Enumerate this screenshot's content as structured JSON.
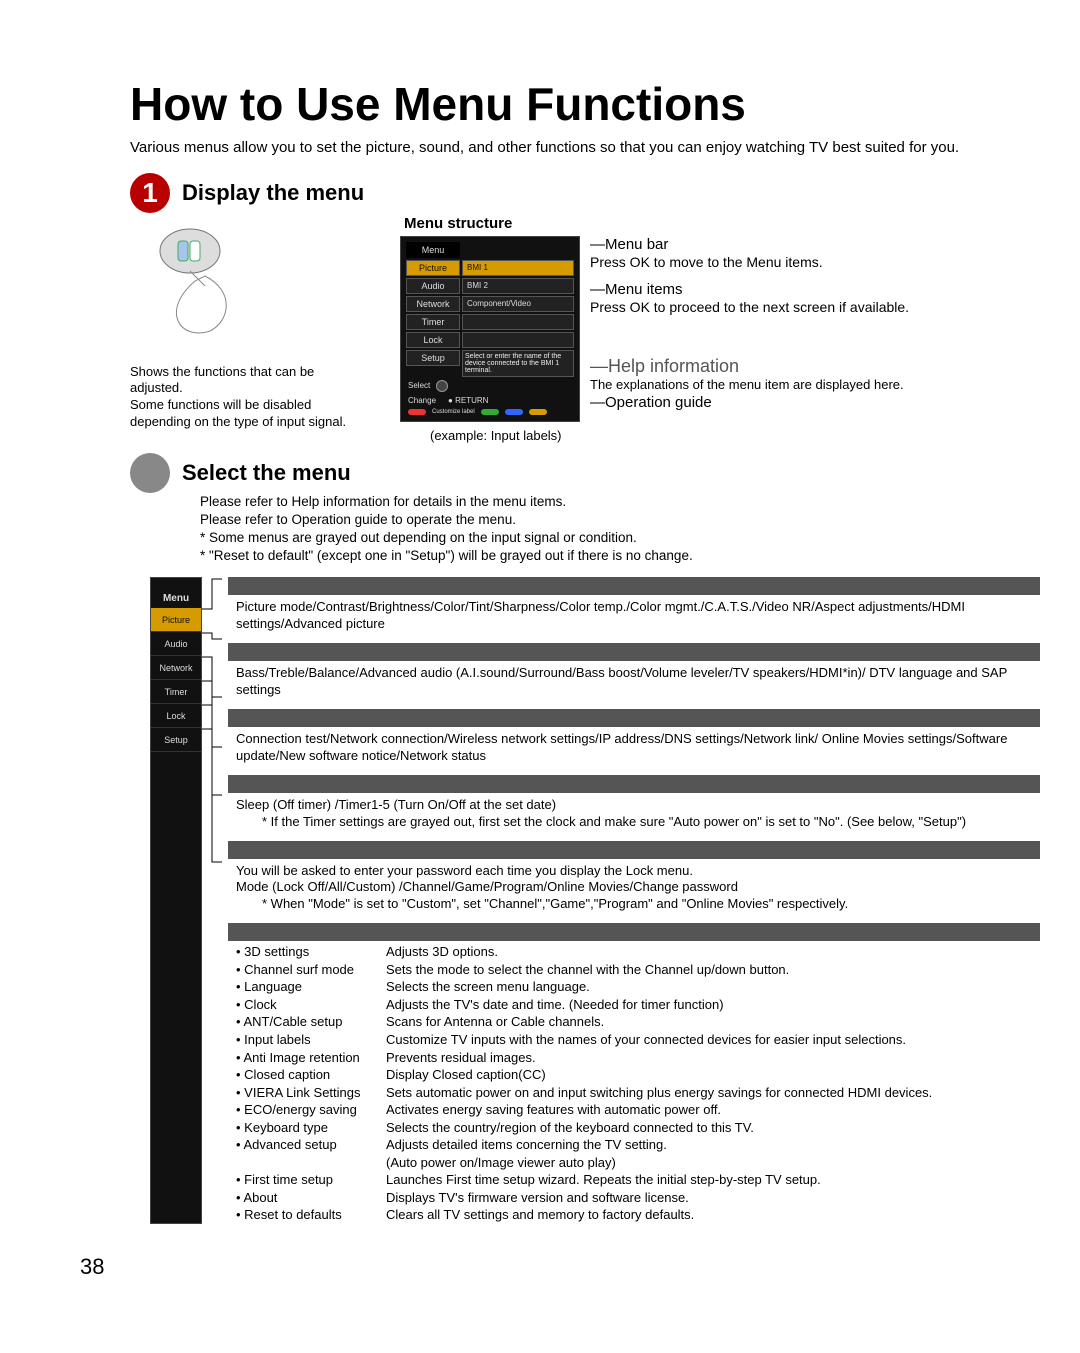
{
  "page_number": "38",
  "title": "How to Use Menu Functions",
  "intro": "Various menus allow you to set the picture, sound, and other functions so that you can enjoy watching TV best suited for you.",
  "step1": {
    "number": "1",
    "title": "Display the menu",
    "remote_text": "Shows the functions that can be adjusted.\nSome functions will be disabled depending on the type of input signal.",
    "menu_structure_title": "Menu structure",
    "example_label": "(example: Input labels)",
    "screenshot": {
      "menu_label": "Menu",
      "tabs": [
        "Picture",
        "Audio",
        "Network",
        "Timer",
        "Lock",
        "Setup"
      ],
      "rows": [
        "BMI 1",
        "BMI 2",
        "Component/Video"
      ],
      "help_text": "Select or enter the name of the device connected to the BMI 1 terminal.",
      "select_label": "Select",
      "change_label": "Change",
      "return_label": "RETURN",
      "custom_label": "Customize label"
    },
    "annot": {
      "bar_title": "Menu bar",
      "bar_text": "Press OK to move to the Menu items.",
      "items_title": "Menu items",
      "items_text": "Press OK to proceed to the next screen if available.",
      "help_title": "Help information",
      "help_text": "The explanations of the menu item are displayed here.",
      "guide_title": "Operation guide"
    }
  },
  "step2": {
    "title": "Select the menu",
    "lines": [
      "Please refer to Help information for details in the menu items.",
      "Please refer to Operation guide to operate the menu.",
      "* Some menus are grayed out depending on the input signal or condition.",
      "* \"Reset to default\" (except one in \"Setup\") will be grayed out if there is no change."
    ]
  },
  "sidebar": {
    "hdr": "Menu",
    "tabs": [
      "Picture",
      "Audio",
      "Network",
      "Timer",
      "Lock",
      "Setup"
    ]
  },
  "sections": {
    "picture": "Picture mode/Contrast/Brightness/Color/Tint/Sharpness/Color temp./Color mgmt./C.A.T.S./Video NR/Aspect adjustments/HDMI settings/Advanced picture",
    "audio": "Bass/Treble/Balance/Advanced audio (A.I.sound/Surround/Bass boost/Volume leveler/TV speakers/HDMI*in)/ DTV language and SAP settings",
    "network": "Connection test/Network connection/Wireless network settings/IP address/DNS settings/Network link/ Online Movies settings/Software update/New software notice/Network status",
    "timer": "Sleep (Off timer) /Timer1-5 (Turn On/Off at the set date)",
    "timer_note": "* If the Timer settings are grayed out, first set the clock and make sure \"Auto power on\" is set to \"No\". (See below, \"Setup\")",
    "lock": "You will be asked to enter your password each time you display the Lock menu.\nMode (Lock Off/All/Custom) /Channel/Game/Program/Online Movies/Change password",
    "lock_note": "* When \"Mode\" is set to \"Custom\", set \"Channel\",\"Game\",\"Program\" and \"Online Movies\" respectively.",
    "setup_items": [
      {
        "lbl": "3D settings",
        "desc": "Adjusts 3D options."
      },
      {
        "lbl": "Channel surf mode",
        "desc": "Sets the mode to select the channel with the Channel up/down button."
      },
      {
        "lbl": "Language",
        "desc": "Selects the screen menu language."
      },
      {
        "lbl": "Clock",
        "desc": "Adjusts the TV's date and time. (Needed for timer function)"
      },
      {
        "lbl": "ANT/Cable setup",
        "desc": "Scans for Antenna or Cable channels."
      },
      {
        "lbl": "Input labels",
        "desc": "Customize TV inputs with the names of your connected devices for easier input selections."
      },
      {
        "lbl": "Anti Image retention",
        "desc": "Prevents residual images."
      },
      {
        "lbl": "Closed caption",
        "desc": "Display Closed caption(CC)"
      },
      {
        "lbl": "VIERA Link Settings",
        "desc": "Sets automatic power on and input switching plus energy savings for connected HDMI devices."
      },
      {
        "lbl": "ECO/energy saving",
        "desc": "Activates energy saving features with automatic power off."
      },
      {
        "lbl": "Keyboard type",
        "desc": "Selects the country/region of the keyboard connected to this TV."
      },
      {
        "lbl": "Advanced setup",
        "desc": "Adjusts detailed items concerning the TV setting.\n(Auto power on/Image viewer auto play)"
      },
      {
        "lbl": "First time setup",
        "desc": "Launches First time setup wizard. Repeats the initial step-by-step TV setup."
      },
      {
        "lbl": "About",
        "desc": "Displays TV's firmware version and software license."
      },
      {
        "lbl": "Reset to defaults",
        "desc": "Clears all TV settings and memory to factory defaults."
      }
    ]
  }
}
